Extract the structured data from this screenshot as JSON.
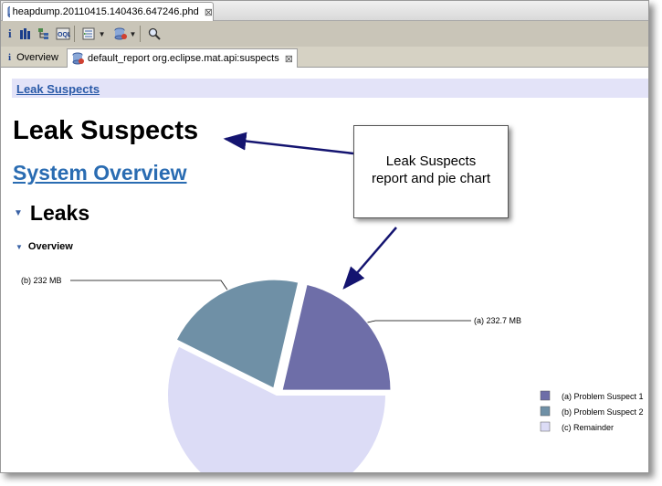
{
  "editor": {
    "tab_title": "heapdump.20110415.140436.647246.phd",
    "close_glyph": "⊠"
  },
  "toolbar": {
    "icons": [
      "info-icon",
      "histogram-icon",
      "dominator-tree-icon",
      "oql-icon",
      "query-browser-icon",
      "heap-dump-overview-icon",
      "search-icon"
    ]
  },
  "subtabs": {
    "overview_label": "Overview",
    "report_label": "default_report  org.eclipse.mat.api:suspects",
    "close_glyph": "⊠"
  },
  "page": {
    "breadcrumb": "Leak Suspects",
    "title": "Leak Suspects",
    "system_overview_link": "System Overview",
    "leaks_heading": "Leaks",
    "overview_heading": "Overview"
  },
  "callout": {
    "line1": "Leak Suspects",
    "line2": "report and pie chart"
  },
  "chart_data": {
    "type": "pie",
    "slices": [
      {
        "label": "(a)",
        "value_mb": 232.7,
        "value_text": "(a)  232.7 MB",
        "color": "#6e6ea8"
      },
      {
        "label": "(b)",
        "value_mb": 232,
        "value_text": "(b)  232 MB",
        "color": "#6f90a6"
      },
      {
        "label": "(c)",
        "value_mb": 625,
        "color": "#dcdcf6"
      }
    ],
    "legend": [
      {
        "text": "(a)  Problem Suspect 1",
        "color": "#6e6ea8"
      },
      {
        "text": "(b)  Problem Suspect 2",
        "color": "#6f90a6"
      },
      {
        "text": "(c)  Remainder",
        "color": "#dcdcf6"
      }
    ],
    "legend_placement": "right"
  }
}
